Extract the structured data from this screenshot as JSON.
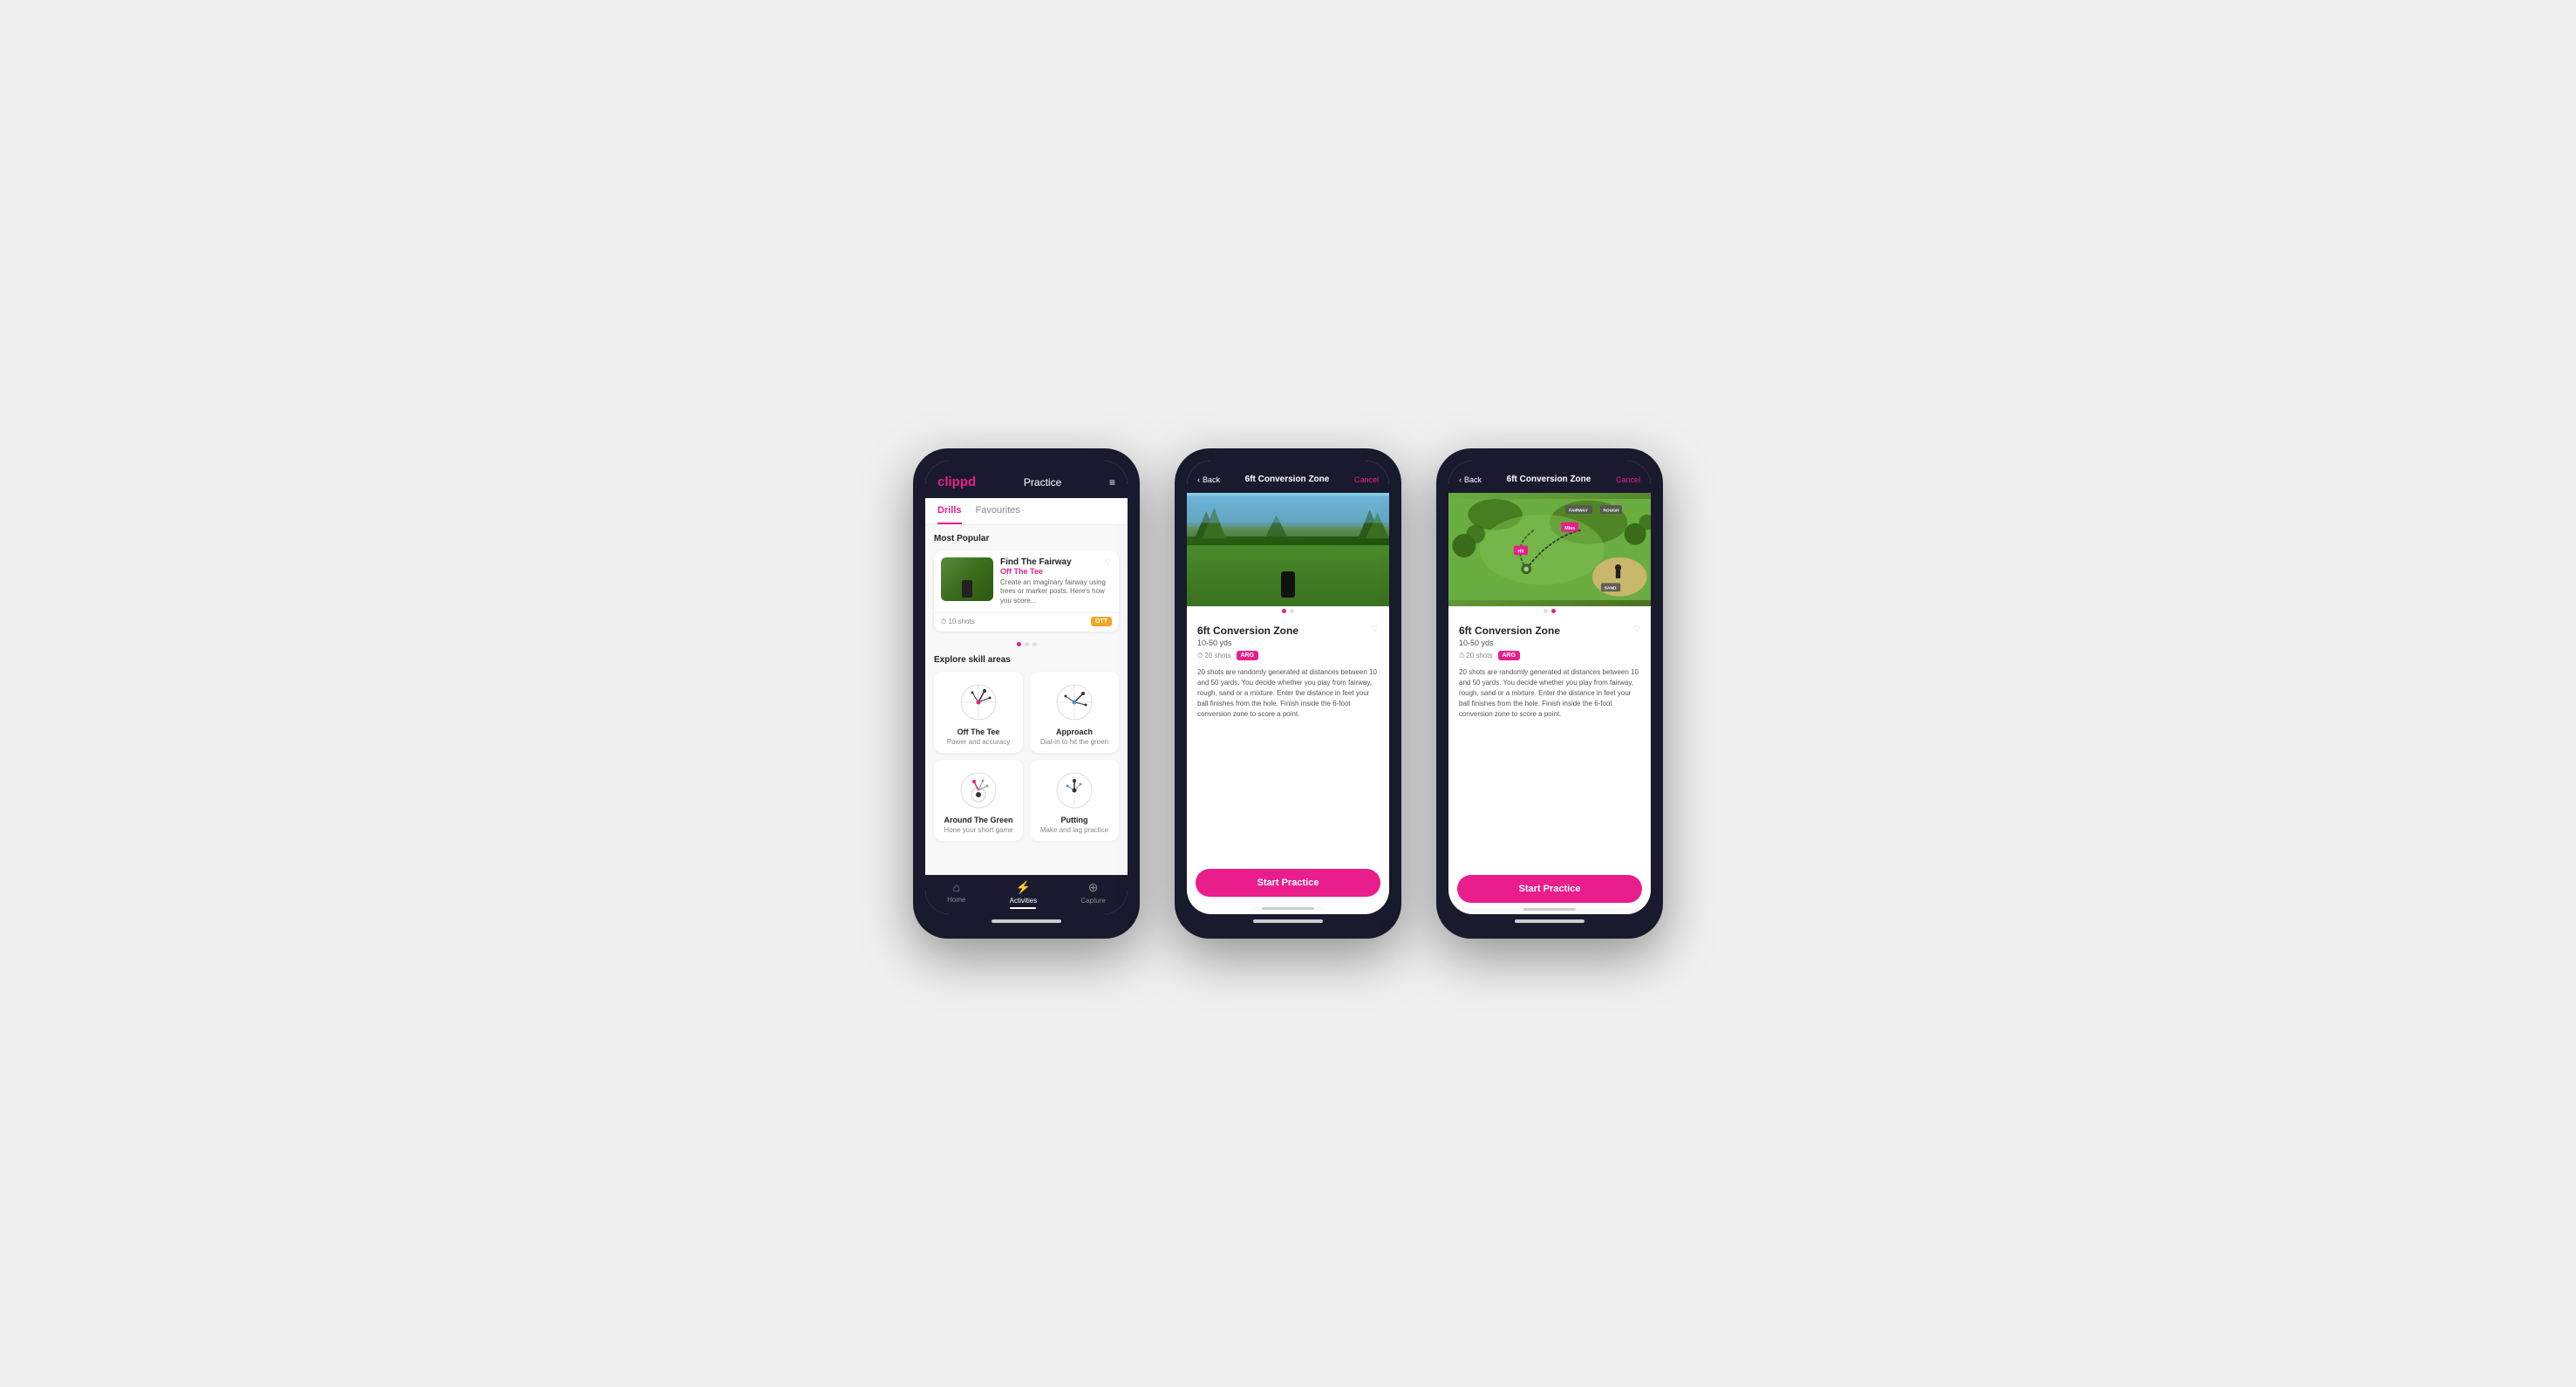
{
  "phone1": {
    "header": {
      "logo": "clippd",
      "title": "Practice",
      "menu_icon": "≡"
    },
    "tabs": [
      {
        "label": "Drills",
        "active": true
      },
      {
        "label": "Favourites",
        "active": false
      }
    ],
    "most_popular_label": "Most Popular",
    "featured_drill": {
      "title": "Find The Fairway",
      "subtitle": "Off The Tee",
      "description": "Create an imaginary fairway using trees or marker posts. Here's how you score...",
      "shots": "10 shots",
      "tag": "OTT"
    },
    "explore_label": "Explore skill areas",
    "skills": [
      {
        "name": "Off The Tee",
        "desc": "Power and accuracy"
      },
      {
        "name": "Approach",
        "desc": "Dial-in to hit the green"
      },
      {
        "name": "Around The Green",
        "desc": "Hone your short game"
      },
      {
        "name": "Putting",
        "desc": "Make and lag practice"
      }
    ],
    "bottom_nav": [
      {
        "label": "Home",
        "icon": "⌂",
        "active": false
      },
      {
        "label": "Activities",
        "icon": "⚡",
        "active": true
      },
      {
        "label": "Capture",
        "icon": "⊕",
        "active": false
      }
    ]
  },
  "phone2": {
    "header": {
      "back": "Back",
      "title": "6ft Conversion Zone",
      "cancel": "Cancel"
    },
    "drill": {
      "title": "6ft Conversion Zone",
      "range": "10-50 yds",
      "shots": "20 shots",
      "tag": "ARG",
      "description": "20 shots are randomly generated at distances between 10 and 50 yards. You decide whether you play from fairway, rough, sand or a mixture. Enter the distance in feet your ball finishes from the hole. Finish inside the 6-foot conversion zone to score a point."
    },
    "cta": "Start Practice"
  },
  "phone3": {
    "header": {
      "back": "Back",
      "title": "6ft Conversion Zone",
      "cancel": "Cancel"
    },
    "drill": {
      "title": "6ft Conversion Zone",
      "range": "10-50 yds",
      "shots": "20 shots",
      "tag": "ARG",
      "description": "20 shots are randomly generated at distances between 10 and 50 yards. You decide whether you play from fairway, rough, sand or a mixture. Enter the distance in feet your ball finishes from the hole. Finish inside the 6-foot conversion zone to score a point."
    },
    "map_labels": {
      "fairway": "FAIRWAY",
      "rough": "ROUGH",
      "miss": "Miss",
      "hit": "Hit",
      "sand": "SAND"
    },
    "cta": "Start Practice"
  }
}
